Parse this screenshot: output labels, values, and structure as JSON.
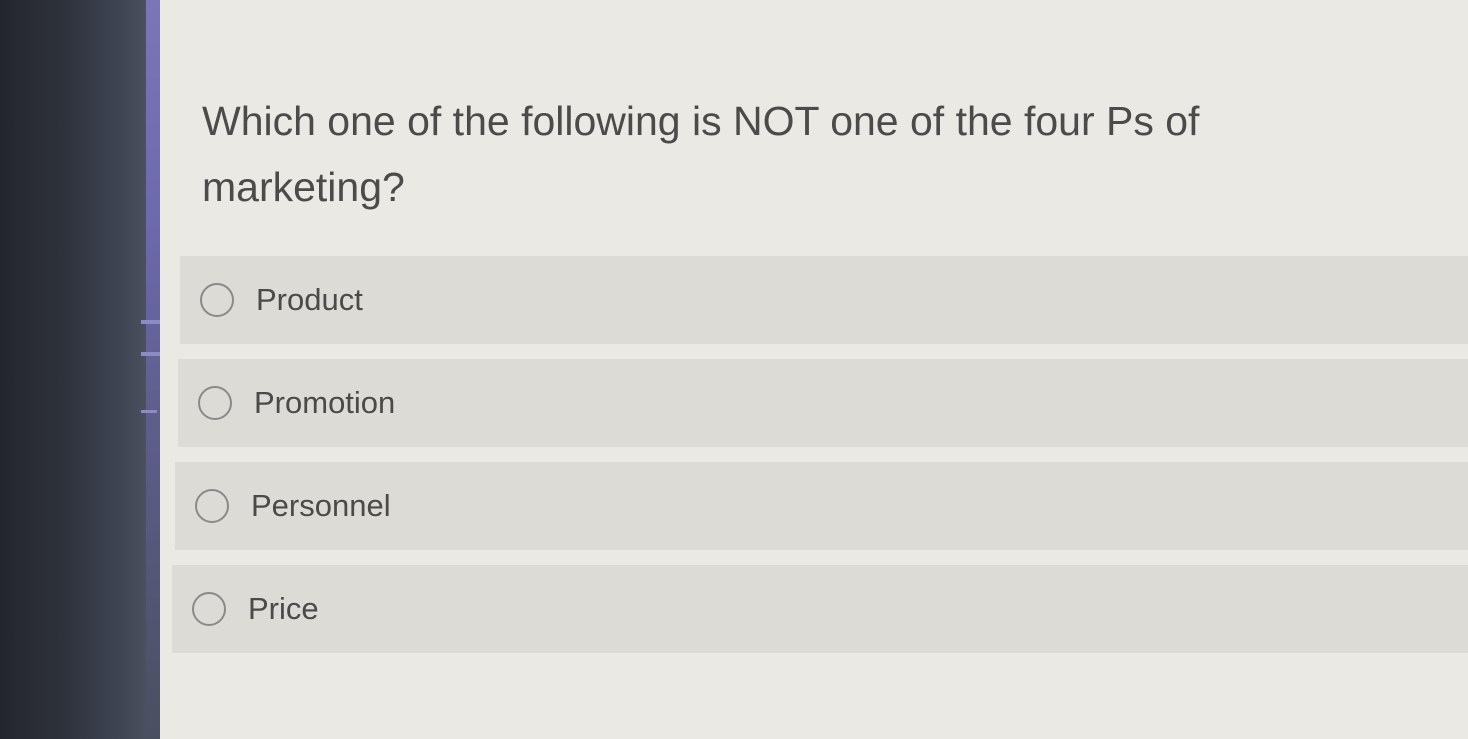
{
  "question": {
    "text": "Which one of the following is NOT one of the four Ps of marketing?"
  },
  "options": [
    {
      "label": "Product",
      "selected": false
    },
    {
      "label": "Promotion",
      "selected": false
    },
    {
      "label": "Personnel",
      "selected": false
    },
    {
      "label": "Price",
      "selected": false
    }
  ],
  "colors": {
    "bezel": "#2f333c",
    "accent": "#7a76b8",
    "background": "#ebe9e4",
    "option_row": "#dddbd6",
    "text": "#4b4b4b"
  }
}
